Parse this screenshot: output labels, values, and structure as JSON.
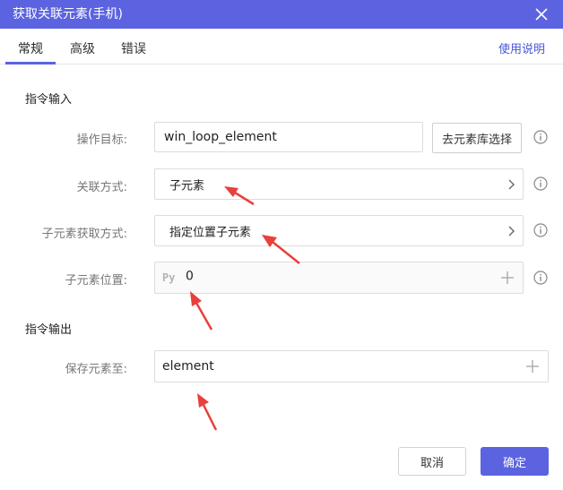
{
  "window": {
    "title": "获取关联元素(手机)"
  },
  "tabs": [
    {
      "label": "常规"
    },
    {
      "label": "高级"
    },
    {
      "label": "错误"
    }
  ],
  "help_link": "使用说明",
  "input_section": {
    "title": "指令输入",
    "target": {
      "label": "操作目标:",
      "value": "win_loop_element",
      "pick_button": "去元素库选择"
    },
    "relation": {
      "label": "关联方式:",
      "value": "子元素"
    },
    "child_method": {
      "label": "子元素获取方式:",
      "value": "指定位置子元素"
    },
    "child_position": {
      "label": "子元素位置:",
      "prefix": "Py",
      "value": "0"
    }
  },
  "output_section": {
    "title": "指令输出",
    "save_to": {
      "label": "保存元素至:",
      "value": "element"
    }
  },
  "buttons": {
    "cancel": "取消",
    "ok": "确定"
  },
  "colors": {
    "accent": "#5b63e0",
    "annotation": "#e8403a"
  }
}
